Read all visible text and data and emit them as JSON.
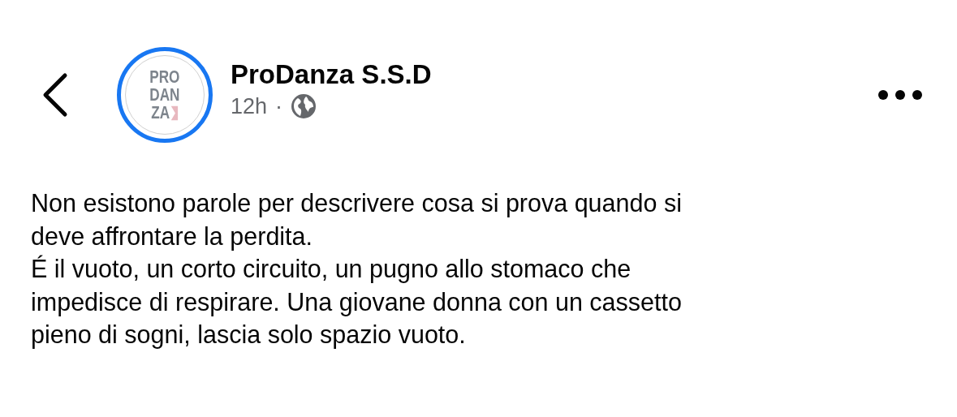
{
  "header": {
    "avatar": {
      "logo_lines": [
        "PRO",
        "DAN",
        "ZA"
      ]
    },
    "page_name": "ProDanza S.S.D",
    "time": "12h",
    "separator": "·"
  },
  "post": {
    "paragraphs": [
      [
        "Non esistono parole per descrivere cosa si prova quando si",
        "deve affrontare la perdita."
      ],
      [
        "É il vuoto, un corto circuito, un pugno allo stomaco che",
        "impedisce di respirare. Una giovane donna con un cassetto",
        "pieno di sogni, lascia solo spazio vuoto."
      ]
    ]
  }
}
